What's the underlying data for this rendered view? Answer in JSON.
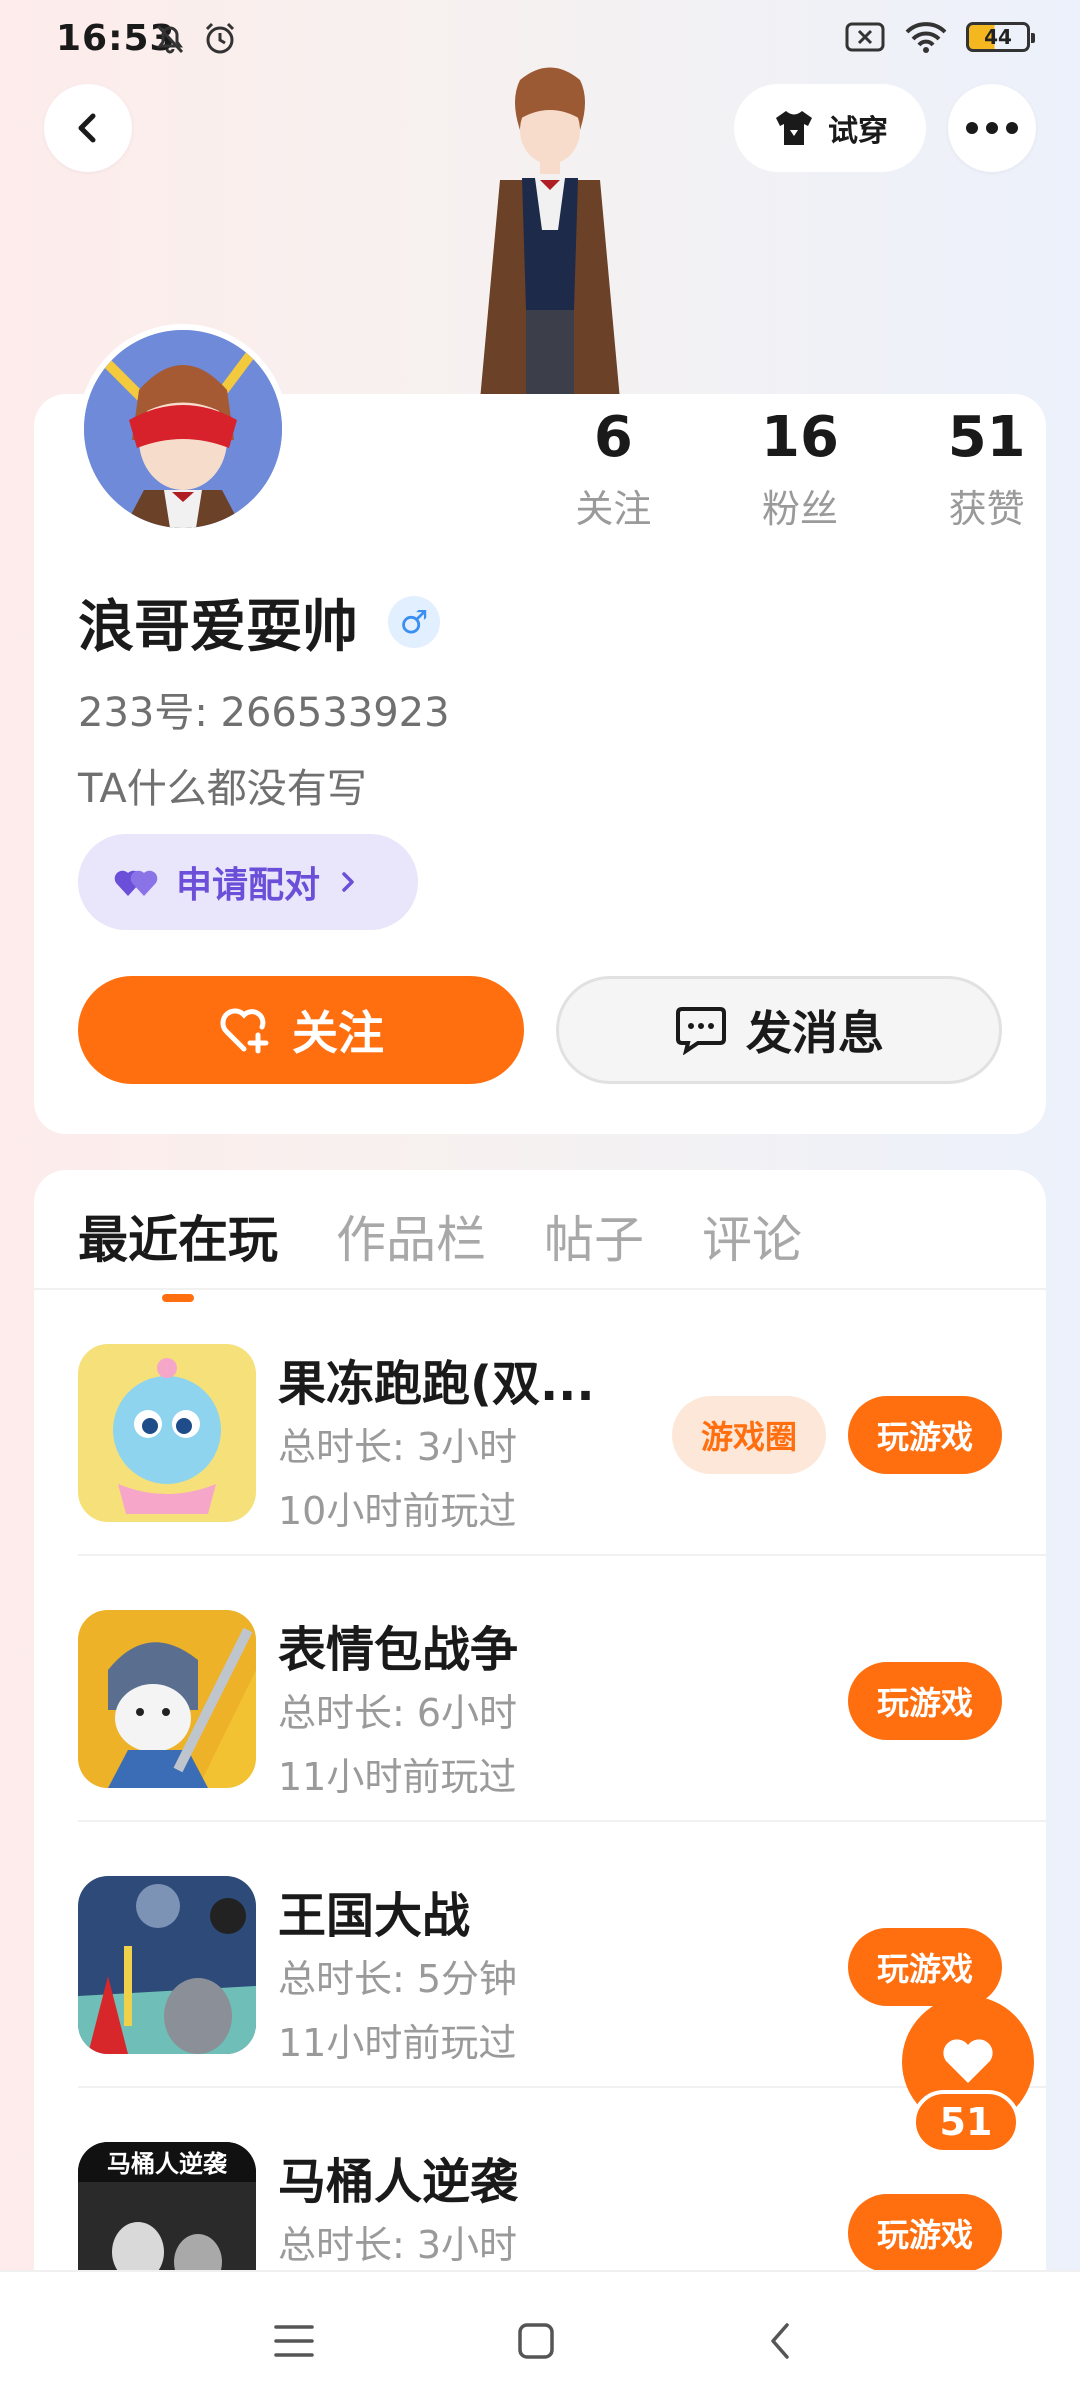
{
  "status_bar": {
    "time": "16:53",
    "battery": "44"
  },
  "header": {
    "tryon_label": "试穿"
  },
  "profile": {
    "stats": [
      {
        "value": "6",
        "label": "关注"
      },
      {
        "value": "16",
        "label": "粉丝"
      },
      {
        "value": "51",
        "label": "获赞"
      }
    ],
    "nickname": "浪哥爱耍帅",
    "gender_symbol": "♂",
    "uid": "233号: 266533923",
    "bio": "TA什么都没有写",
    "pair_label": "申请配对",
    "follow_label": "关注",
    "message_label": "发消息"
  },
  "tabs": [
    {
      "label": "最近在玩",
      "active": true
    },
    {
      "label": "作品栏",
      "active": false
    },
    {
      "label": "帖子",
      "active": false
    },
    {
      "label": "评论",
      "active": false
    }
  ],
  "games": [
    {
      "title": "果冻跑跑(双...",
      "duration": "总时长: 3小时",
      "last_played": "10小时前玩过",
      "circle_label": "游戏圈",
      "play_label": "玩游戏"
    },
    {
      "title": "表情包战争",
      "duration": "总时长: 6小时",
      "last_played": "11小时前玩过",
      "play_label": "玩游戏"
    },
    {
      "title": "王国大战",
      "duration": "总时长: 5分钟",
      "last_played": "11小时前玩过",
      "play_label": "玩游戏"
    },
    {
      "title": "马桶人逆袭",
      "duration": "总时长: 3小时",
      "last_played": "",
      "play_label": "玩游戏",
      "icon_text": "马桶人逆袭"
    }
  ],
  "like_count": "51",
  "colors": {
    "accent": "#ff6f0f",
    "pair_purple": "#6b4fd8"
  }
}
